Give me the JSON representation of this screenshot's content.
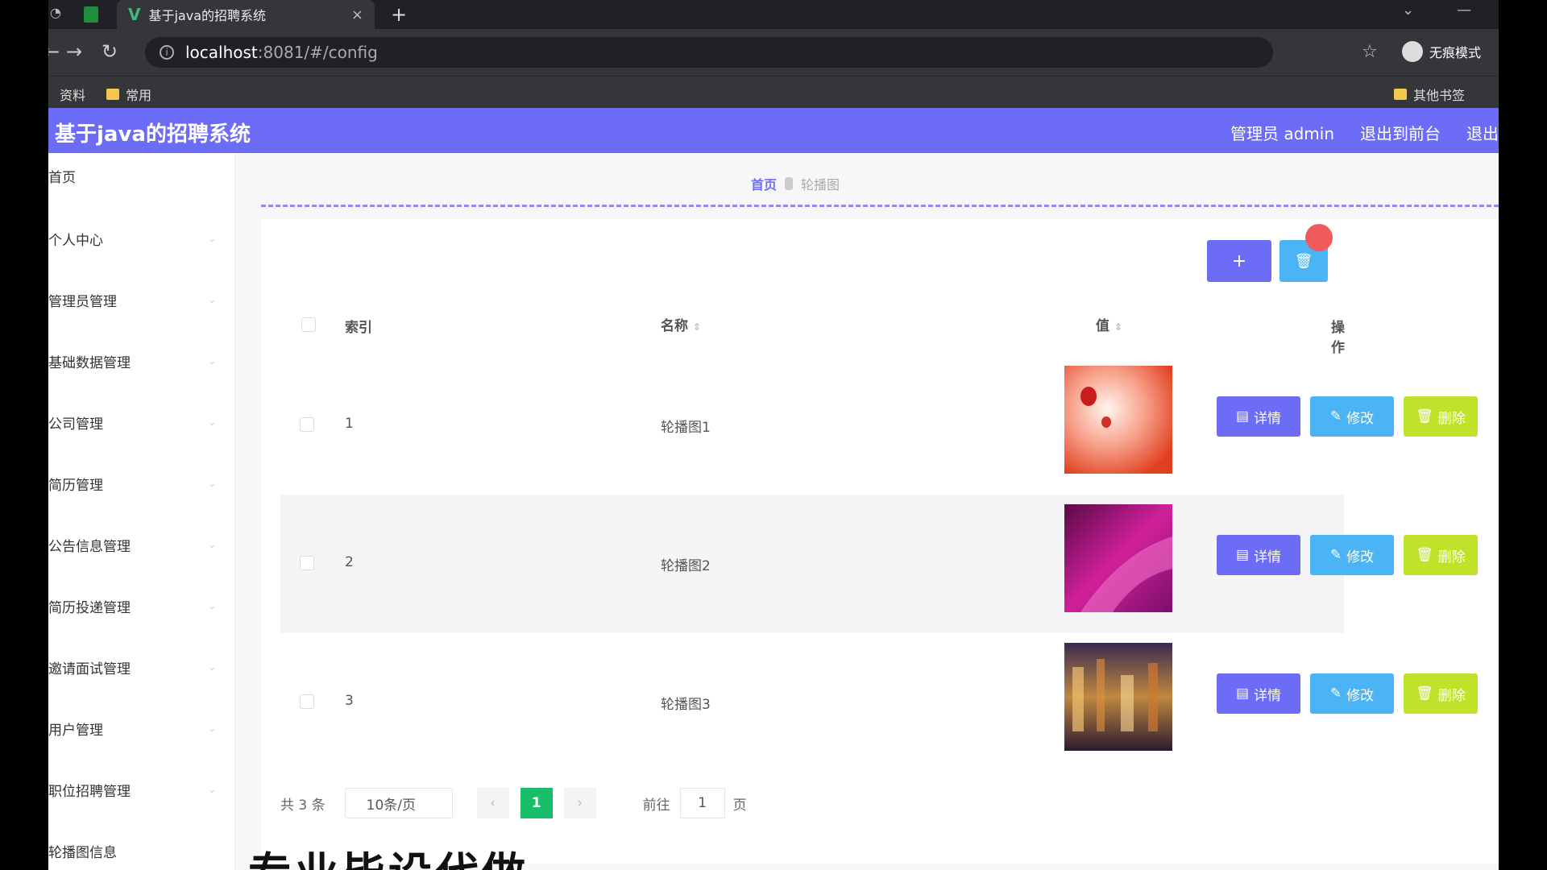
{
  "browser": {
    "tab_title": "基于java的招聘系统",
    "tab_close": "×",
    "new_tab": "+",
    "url_host": "localhost",
    "url_path": ":8081/#/config",
    "incognito_label": "无痕模式",
    "bookmarks": [
      "资料",
      "常用"
    ],
    "other_bookmarks": "其他书签"
  },
  "app": {
    "title": "基于java的招聘系统",
    "user": "管理员 admin",
    "to_front": "退出到前台",
    "logout": "退出"
  },
  "sidebar": {
    "items": [
      "首页",
      "个人中心",
      "管理员管理",
      "基础数据管理",
      "公司管理",
      "简历管理",
      "公告信息管理",
      "简历投递管理",
      "邀请面试管理",
      "用户管理",
      "职位招聘管理",
      "轮播图信息"
    ]
  },
  "breadcrumb": {
    "home": "首页",
    "current": "轮播图"
  },
  "toolbar": {
    "add": "+",
    "delete_icon": "🗑"
  },
  "table": {
    "headers": {
      "index": "索引",
      "name": "名称",
      "value": "值",
      "ops": "操作"
    },
    "rows": [
      {
        "index": "1",
        "name": "轮播图1"
      },
      {
        "index": "2",
        "name": "轮播图2"
      },
      {
        "index": "3",
        "name": "轮播图3"
      }
    ],
    "ops": {
      "detail": "详情",
      "edit": "修改",
      "delete": "删除"
    }
  },
  "pagination": {
    "total": "共 3 条",
    "page_size": "10条/页",
    "prev": "‹",
    "current": "1",
    "next": "›",
    "goto": "前往",
    "goto_value": "1",
    "page": "页"
  },
  "overlay": {
    "text": "专业毕设代做"
  },
  "colors": {
    "primary": "#6c6cf7",
    "info": "#4ab4f5",
    "danger": "#c0e22a",
    "page_active": "#19be6b"
  }
}
